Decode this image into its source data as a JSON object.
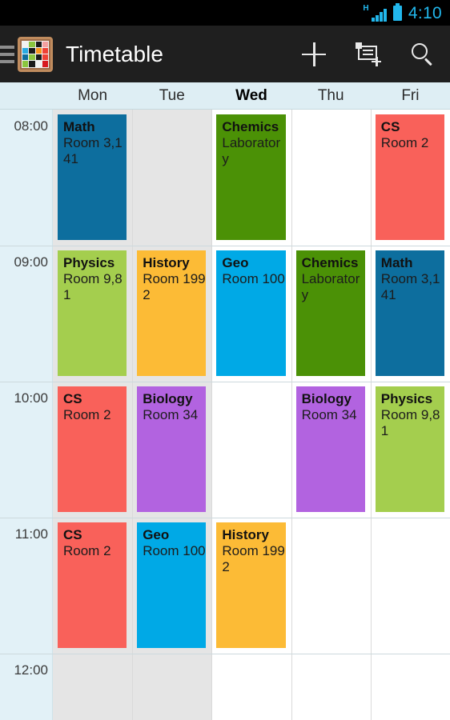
{
  "status_bar": {
    "network_type": "H",
    "signal_icon": "signal-bars-icon",
    "battery_icon": "battery-icon",
    "time": "4:10",
    "accent_color": "#22b7ec"
  },
  "action_bar": {
    "drawer_icon": "hamburger-menu-icon",
    "app_icon": "app-logo-icon",
    "app_icon_colors": [
      "#f2f2f2",
      "#8bc53f",
      "#1a1a1a",
      "#f4a0a0",
      "#29abe2",
      "#1a1a1a",
      "#f7941e",
      "#ef4136",
      "#0d6e9e",
      "#8bc53f",
      "#1a1a1a",
      "#ef4136",
      "#8bc53f",
      "#1a1a1a",
      "#f2f2f2",
      "#d81920"
    ],
    "title": "Timetable",
    "actions": [
      {
        "name": "add-lesson-button",
        "icon": "plus-icon",
        "label": "Add"
      },
      {
        "name": "new-lesson-button",
        "icon": "new-card-plus-icon",
        "label": "New lesson"
      },
      {
        "name": "search-button",
        "icon": "search-icon",
        "label": "Search"
      }
    ]
  },
  "timetable": {
    "days": [
      {
        "label": "Mon",
        "today": false,
        "past": true
      },
      {
        "label": "Tue",
        "today": false,
        "past": true
      },
      {
        "label": "Wed",
        "today": true,
        "past": false
      },
      {
        "label": "Thu",
        "today": false,
        "past": false
      },
      {
        "label": "Fri",
        "today": false,
        "past": false
      }
    ],
    "times": [
      "08:00",
      "09:00",
      "10:00",
      "11:00",
      "12:00"
    ],
    "colors": {
      "math": "#0d6e9e",
      "physics": "#a4ce4e",
      "chemics": "#4b9106",
      "history": "#fcbb36",
      "geo": "#00a9e6",
      "cs": "#f9615a",
      "biology": "#b263e0",
      "gutter_bg": "#e2f1f7",
      "past_day_bg": "#e5e5e5",
      "header_bg": "#deeef4"
    },
    "events": [
      {
        "day": 0,
        "slot": 0,
        "title": "Math",
        "room": "Room 3,141",
        "color": "#0d6e9e"
      },
      {
        "day": 2,
        "slot": 0,
        "title": "Chemics",
        "room": "Laboratory",
        "color": "#4b9106"
      },
      {
        "day": 4,
        "slot": 0,
        "title": "CS",
        "room": "Room 2",
        "color": "#f9615a"
      },
      {
        "day": 0,
        "slot": 1,
        "title": "Physics",
        "room": "Room 9,81",
        "color": "#a4ce4e"
      },
      {
        "day": 1,
        "slot": 1,
        "title": "History",
        "room": "Room 1992",
        "color": "#fcbb36"
      },
      {
        "day": 2,
        "slot": 1,
        "title": "Geo",
        "room": "Room 100",
        "color": "#00a9e6"
      },
      {
        "day": 3,
        "slot": 1,
        "title": "Chemics",
        "room": "Laboratory",
        "color": "#4b9106"
      },
      {
        "day": 4,
        "slot": 1,
        "title": "Math",
        "room": "Room 3,141",
        "color": "#0d6e9e"
      },
      {
        "day": 0,
        "slot": 2,
        "title": "CS",
        "room": "Room 2",
        "color": "#f9615a"
      },
      {
        "day": 1,
        "slot": 2,
        "title": "Biology",
        "room": "Room 34",
        "color": "#b263e0"
      },
      {
        "day": 3,
        "slot": 2,
        "title": "Biology",
        "room": "Room 34",
        "color": "#b263e0"
      },
      {
        "day": 4,
        "slot": 2,
        "title": "Physics",
        "room": "Room 9,81",
        "color": "#a4ce4e"
      },
      {
        "day": 0,
        "slot": 3,
        "title": "CS",
        "room": "Room 2",
        "color": "#f9615a"
      },
      {
        "day": 1,
        "slot": 3,
        "title": "Geo",
        "room": "Room 100",
        "color": "#00a9e6"
      },
      {
        "day": 2,
        "slot": 3,
        "title": "History",
        "room": "Room 1992",
        "color": "#fcbb36"
      }
    ]
  }
}
